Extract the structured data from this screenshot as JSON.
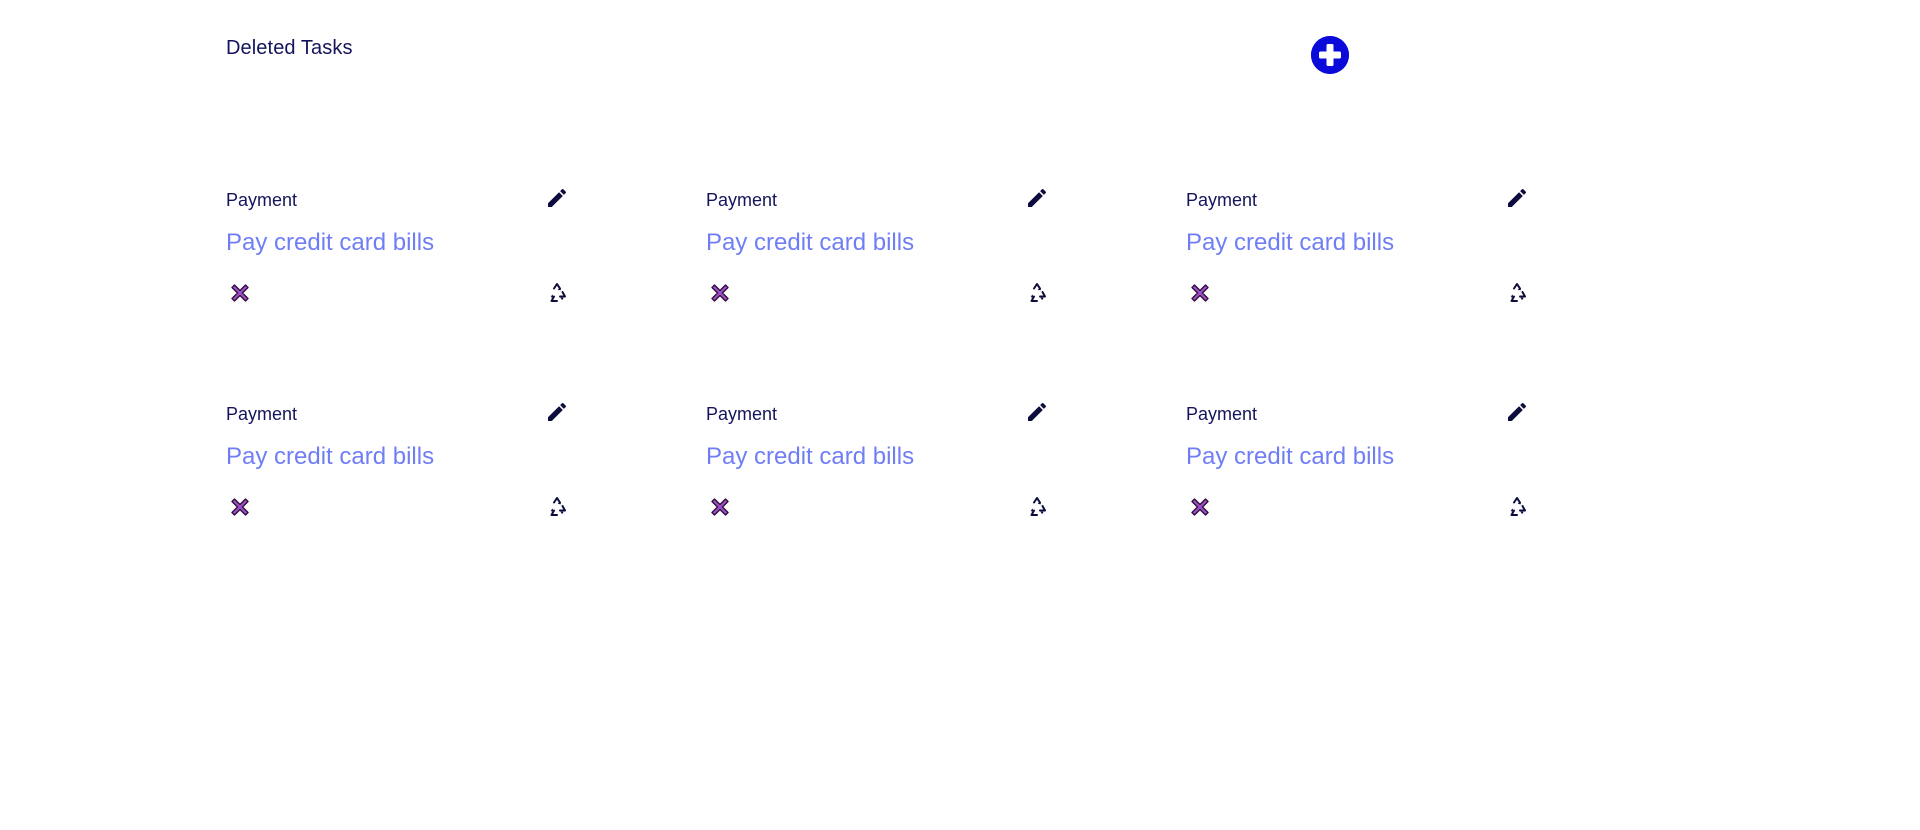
{
  "header": {
    "title": "Deleted Tasks",
    "add_icon": "plus-circle-icon"
  },
  "colors": {
    "title": "#14145c",
    "accent": "#0a0adb",
    "description": "#6f7ef5",
    "delete_icon_fill": "#a14fc4"
  },
  "tasks": [
    {
      "category": "Payment",
      "description": "Pay credit card bills",
      "edit_icon": "pencil-icon",
      "delete_icon": "cross-mark-icon",
      "restore_icon": "recycle-icon"
    },
    {
      "category": "Payment",
      "description": "Pay credit card bills",
      "edit_icon": "pencil-icon",
      "delete_icon": "cross-mark-icon",
      "restore_icon": "recycle-icon"
    },
    {
      "category": "Payment",
      "description": "Pay credit card bills",
      "edit_icon": "pencil-icon",
      "delete_icon": "cross-mark-icon",
      "restore_icon": "recycle-icon"
    },
    {
      "category": "Payment",
      "description": "Pay credit card bills",
      "edit_icon": "pencil-icon",
      "delete_icon": "cross-mark-icon",
      "restore_icon": "recycle-icon"
    },
    {
      "category": "Payment",
      "description": "Pay credit card bills",
      "edit_icon": "pencil-icon",
      "delete_icon": "cross-mark-icon",
      "restore_icon": "recycle-icon"
    },
    {
      "category": "Payment",
      "description": "Pay credit card bills",
      "edit_icon": "pencil-icon",
      "delete_icon": "cross-mark-icon",
      "restore_icon": "recycle-icon"
    }
  ]
}
